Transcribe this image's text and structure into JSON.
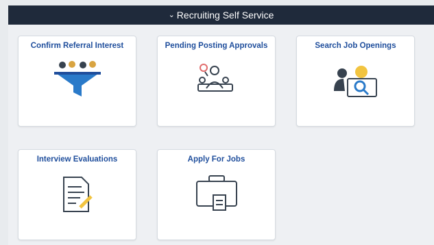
{
  "header": {
    "title": "Recruiting Self Service",
    "chevron_icon": "chevron-down-icon"
  },
  "tiles": [
    {
      "title": "Confirm Referral Interest",
      "icon": "funnel-icon"
    },
    {
      "title": "Pending Posting Approvals",
      "icon": "approver-icon"
    },
    {
      "title": "Search Job Openings",
      "icon": "search-monitor-icon"
    },
    {
      "title": "Interview Evaluations",
      "icon": "evaluation-document-icon"
    },
    {
      "title": "Apply For Jobs",
      "icon": "briefcase-icon"
    }
  ],
  "colors": {
    "header_bg": "#1f2a3b",
    "tile_title": "#1f4e9c",
    "icon_blue": "#2a7ac9",
    "icon_dark": "#37424f"
  }
}
